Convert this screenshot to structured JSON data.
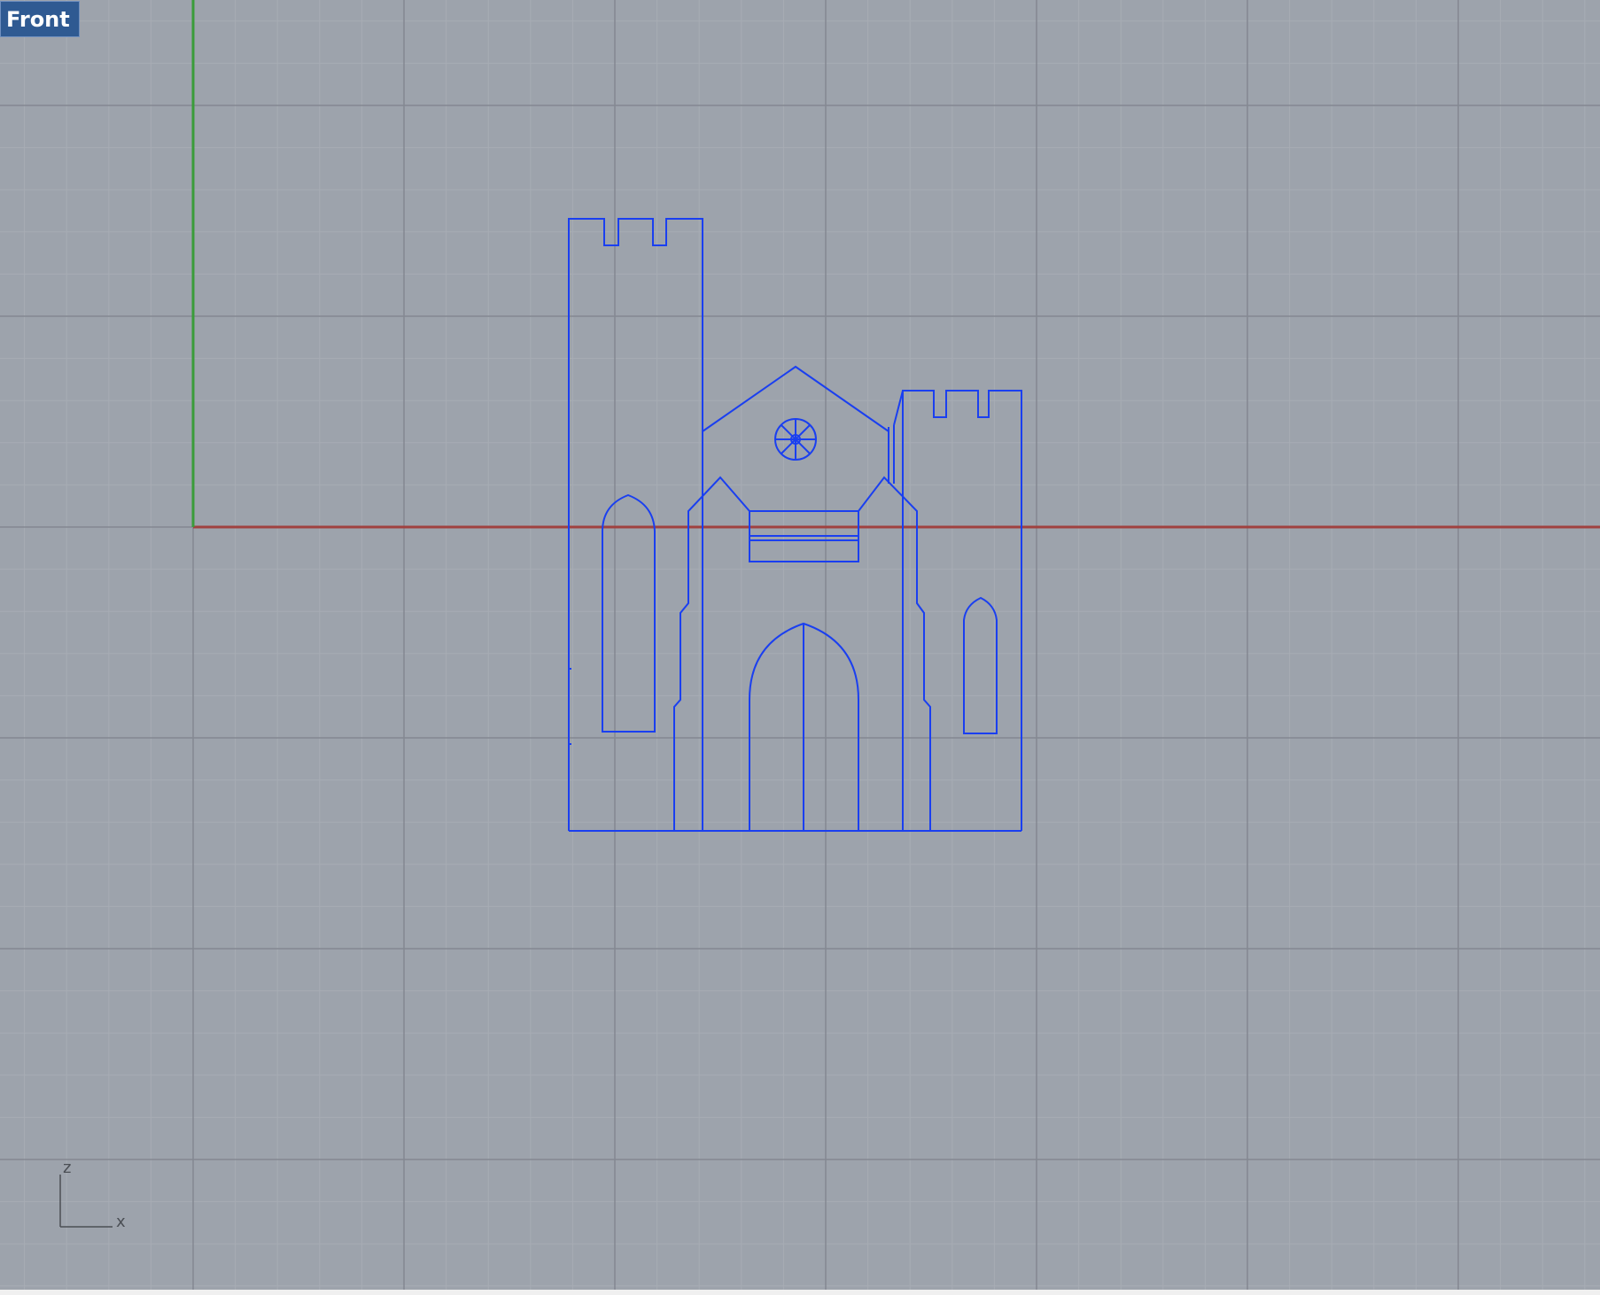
{
  "viewport": {
    "label": "Front"
  },
  "gizmo": {
    "vertical_axis": "z",
    "horizontal_axis": "x"
  },
  "colors": {
    "background": "#9da3ac",
    "minor_grid": "#a7acb4",
    "major_grid": "#838891",
    "x_axis": "#a0413f",
    "z_axis": "#3a9c3a",
    "curves": "#1a3ff0"
  }
}
